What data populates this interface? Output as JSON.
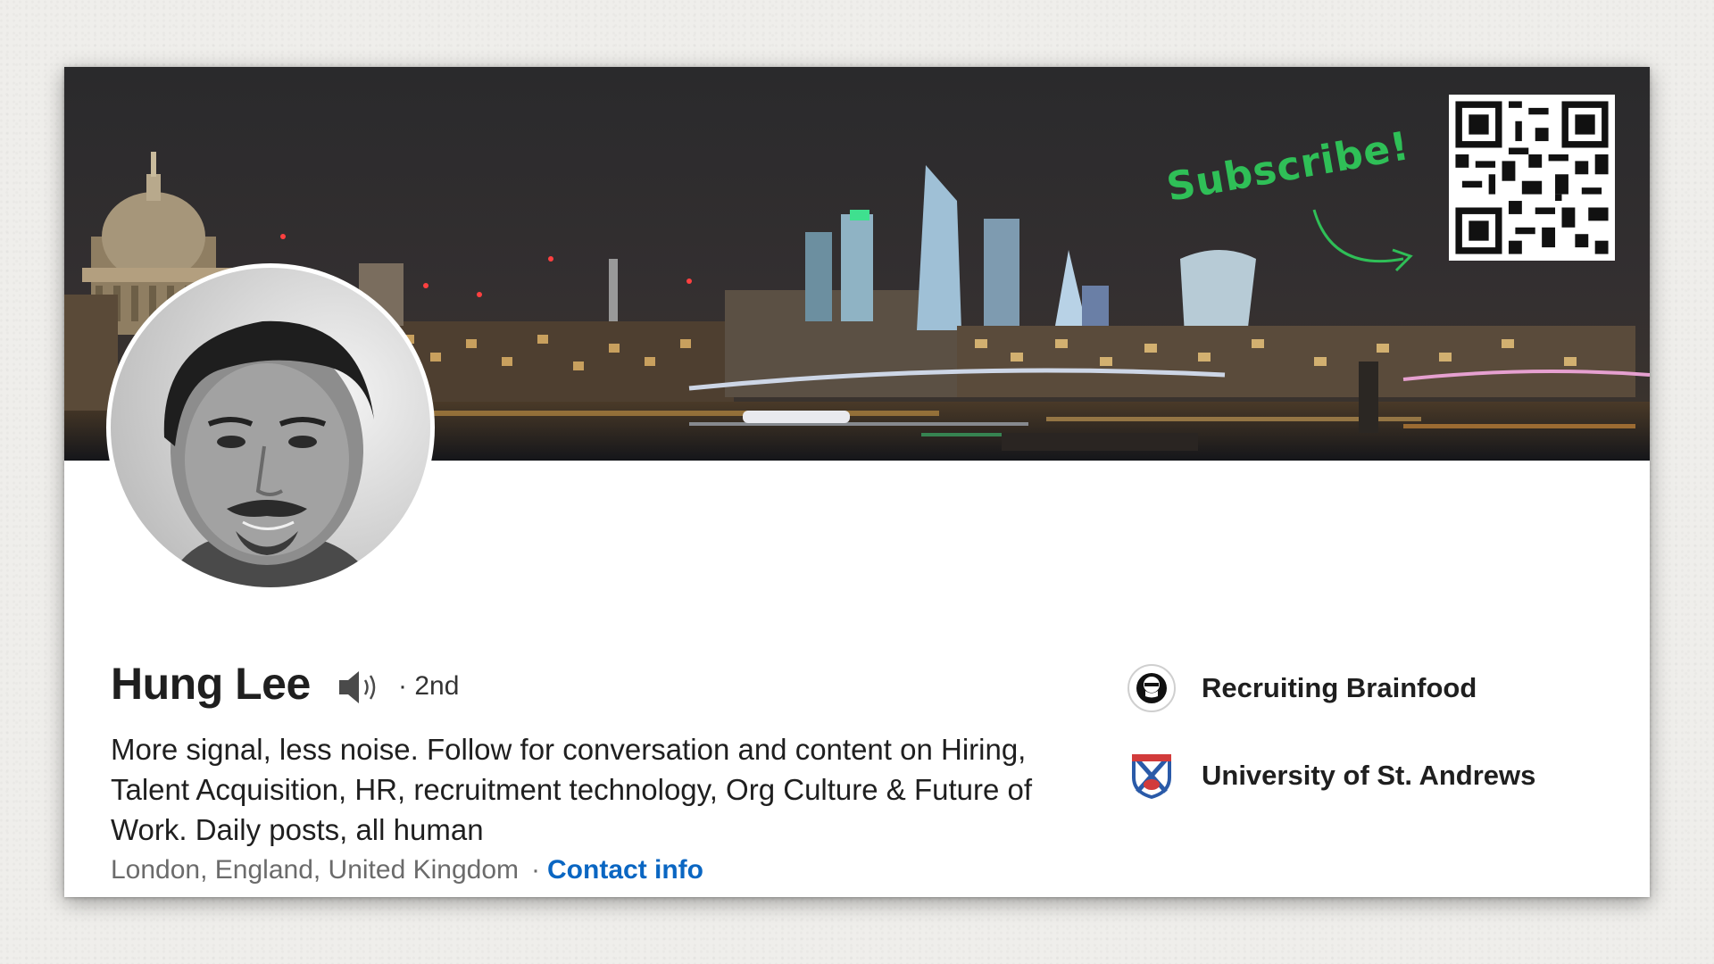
{
  "banner": {
    "subscribe_text": "Subscribe!",
    "accent_color": "#2fbf57"
  },
  "profile": {
    "name": "Hung Lee",
    "name_pronunciation_icon": "speaker-icon",
    "connection_degree": "· 2nd",
    "headline": "More signal, less noise. Follow for conversation and content on Hiring, Talent Acquisition, HR, recruitment technology, Org Culture & Future of Work. Daily posts, all human",
    "location": "London, England, United Kingdom",
    "location_separator": "·",
    "contact_info_label": "Contact info",
    "link_color": "#0a66c2"
  },
  "organizations": [
    {
      "name": "Recruiting Brainfood",
      "icon": "recruiting-brainfood-logo"
    },
    {
      "name": "University of St. Andrews",
      "icon": "st-andrews-crest-logo"
    }
  ]
}
